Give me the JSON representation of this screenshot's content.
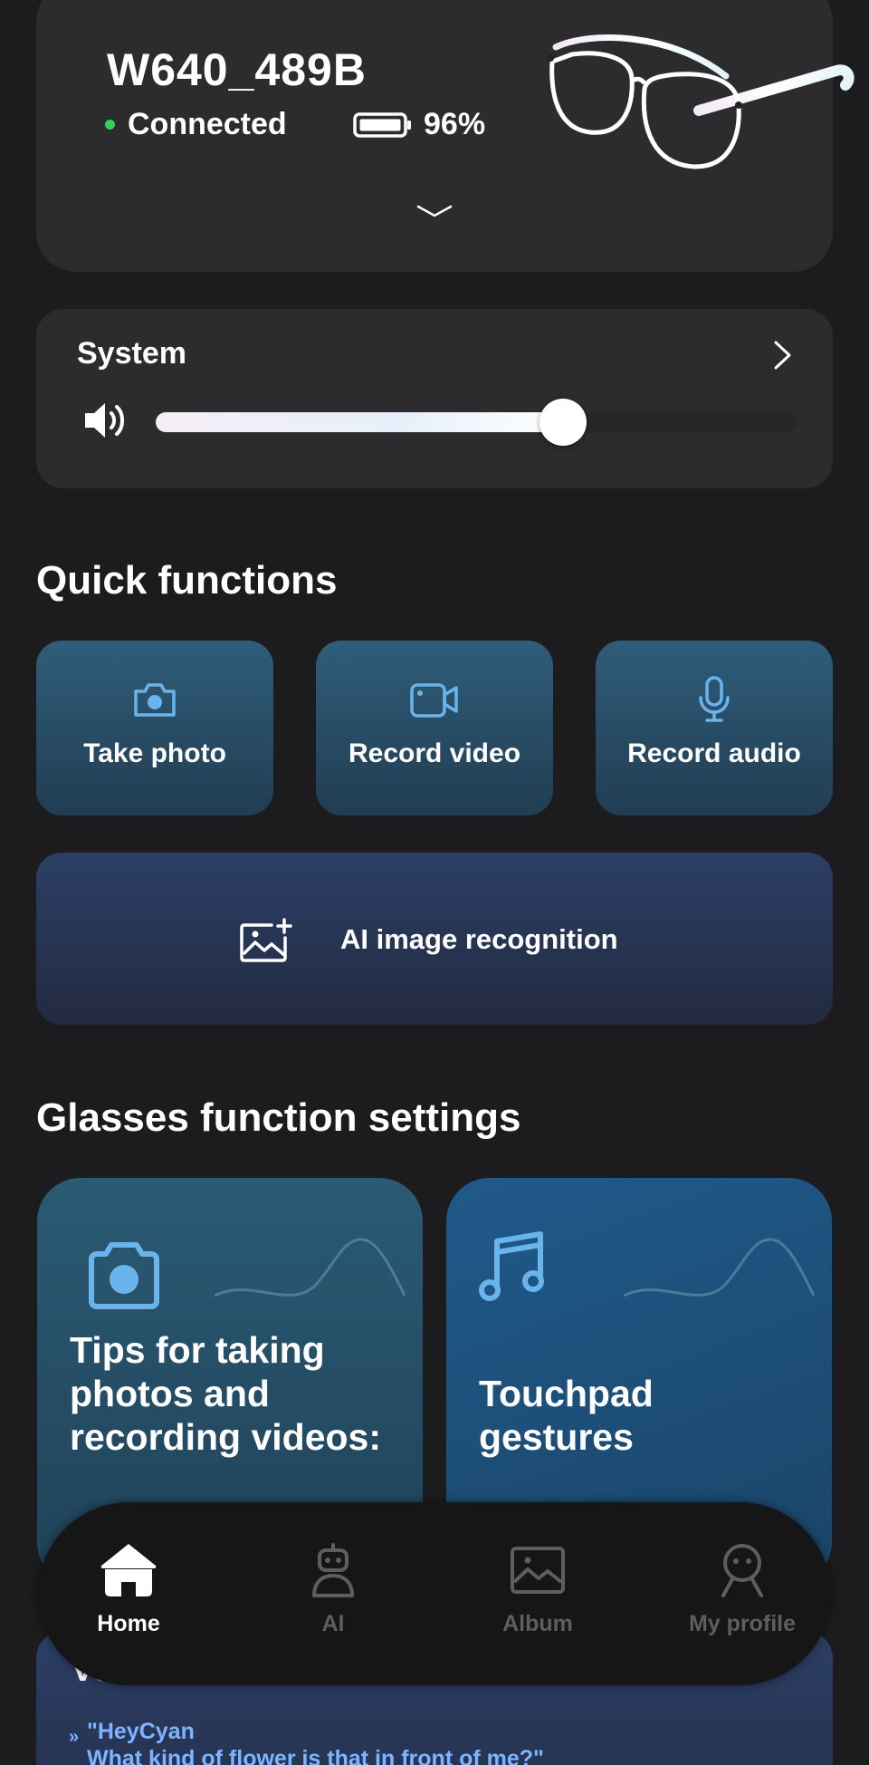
{
  "device": {
    "name": "W640_489B",
    "connection_status": "Connected",
    "battery": "96%",
    "status_color": "#30d158"
  },
  "system": {
    "title": "System",
    "volume_fraction": 0.636
  },
  "quick_functions": {
    "title": "Quick functions",
    "buttons": [
      {
        "label": "Take photo",
        "icon": "camera-icon"
      },
      {
        "label": "Record video",
        "icon": "video-camera-icon"
      },
      {
        "label": "Record audio",
        "icon": "microphone-icon"
      }
    ],
    "ai_recognition_label": "AI image recognition"
  },
  "glasses_settings": {
    "title": "Glasses function settings",
    "cards": [
      {
        "title": "Tips for taking photos and recording videos:",
        "icon": "camera-icon"
      },
      {
        "title": "Touchpad gestures",
        "icon": "music-note-icon"
      }
    ]
  },
  "voice_assistant": {
    "title": "Voice assistant",
    "quote_line1": "\"HeyCyan",
    "quote_line2": "What kind of flower is that in front of me?\""
  },
  "bottom_nav": {
    "items": [
      {
        "label": "Home",
        "icon": "home-icon",
        "active": true
      },
      {
        "label": "AI",
        "icon": "robot-icon",
        "active": false
      },
      {
        "label": "Album",
        "icon": "image-icon",
        "active": false
      },
      {
        "label": "My profile",
        "icon": "profile-icon",
        "active": false
      }
    ]
  },
  "colors": {
    "background": "#1c1c1e",
    "card": "#2c2c2e",
    "accent_blue": "#7fb3ff",
    "icon_blue": "#6ab4ec"
  }
}
